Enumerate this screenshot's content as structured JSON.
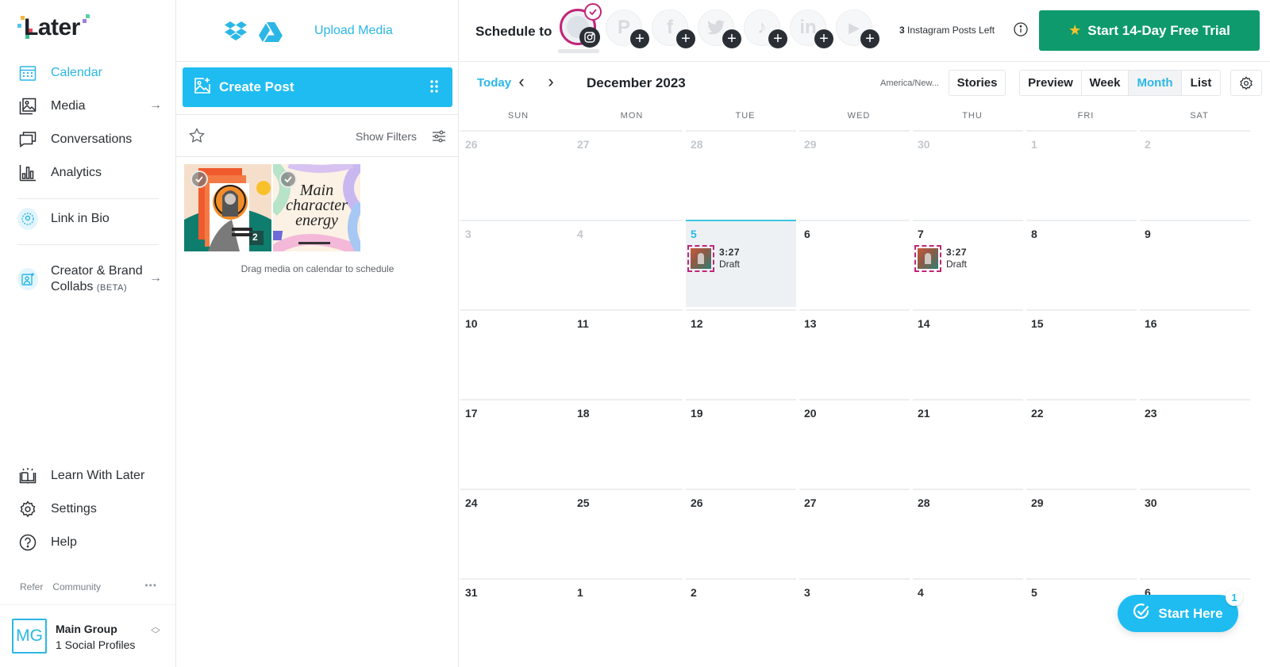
{
  "brand": {
    "name": "Later",
    "accent": "#2bb7e6",
    "trial_green": "#0e9a6c",
    "draft_magenta": "#c0267a"
  },
  "sidebar": {
    "items": [
      {
        "label": "Calendar",
        "icon": "calendar-icon",
        "active": true
      },
      {
        "label": "Media",
        "icon": "media-icon",
        "has_arrow": true
      },
      {
        "label": "Conversations",
        "icon": "conversations-icon"
      },
      {
        "label": "Analytics",
        "icon": "analytics-icon"
      },
      {
        "label": "Link in Bio",
        "icon": "link-in-bio-icon"
      },
      {
        "label": "Creator & Brand",
        "label2": "Collabs",
        "badge": "(BETA)",
        "icon": "collabs-icon",
        "has_arrow": true
      }
    ],
    "bottom_items": [
      {
        "label": "Learn With Later",
        "icon": "book-icon"
      },
      {
        "label": "Settings",
        "icon": "gear-icon"
      },
      {
        "label": "Help",
        "icon": "help-icon"
      }
    ],
    "footer_links": [
      "Refer",
      "Community"
    ],
    "more": "•••",
    "profile": {
      "initials": "MG",
      "name": "Main Group",
      "subtitle": "1 Social Profiles"
    }
  },
  "media_panel": {
    "upload_label": "Upload Media",
    "create_post_label": "Create Post",
    "show_filters_label": "Show Filters",
    "thumbnails": [
      {
        "alt": "Collage post",
        "count": "2"
      },
      {
        "alt": "Main character energy",
        "text_lines": [
          "Main",
          "character",
          "energy"
        ]
      }
    ],
    "drag_hint": "Drag media on calendar to schedule"
  },
  "topbar": {
    "schedule_label": "Schedule to",
    "profiles": [
      {
        "network": "instagram",
        "selected": true
      },
      {
        "network": "pinterest",
        "glyph": "P"
      },
      {
        "network": "facebook",
        "glyph": "f"
      },
      {
        "network": "twitter",
        "glyph": "t"
      },
      {
        "network": "tiktok",
        "glyph": "♪"
      },
      {
        "network": "linkedin",
        "glyph": "in"
      },
      {
        "network": "youtube",
        "glyph": "▶"
      }
    ],
    "posts_left_count": "3",
    "posts_left_text": " Instagram Posts Left",
    "trial_label": "Start 14-Day Free Trial"
  },
  "calendar": {
    "today_label": "Today",
    "month_title": "December 2023",
    "timezone": "America/New...",
    "stories_label": "Stories",
    "views": [
      {
        "label": "Preview",
        "active": false
      },
      {
        "label": "Week",
        "active": false
      },
      {
        "label": "Month",
        "active": true
      },
      {
        "label": "List",
        "active": false
      }
    ],
    "weekdays": [
      "SUN",
      "MON",
      "TUE",
      "WED",
      "THU",
      "FRI",
      "SAT"
    ],
    "weeks": [
      [
        {
          "d": "26",
          "past": true
        },
        {
          "d": "27",
          "past": true
        },
        {
          "d": "28",
          "past": true
        },
        {
          "d": "29",
          "past": true
        },
        {
          "d": "30",
          "past": true
        },
        {
          "d": "1",
          "past": true
        },
        {
          "d": "2",
          "past": true
        }
      ],
      [
        {
          "d": "3",
          "past": true
        },
        {
          "d": "4",
          "past": true
        },
        {
          "d": "5",
          "today": true,
          "events": [
            {
              "time": "3:27",
              "status": "Draft"
            }
          ]
        },
        {
          "d": "6"
        },
        {
          "d": "7",
          "events": [
            {
              "time": "3:27",
              "status": "Draft"
            }
          ]
        },
        {
          "d": "8"
        },
        {
          "d": "9"
        }
      ],
      [
        {
          "d": "10"
        },
        {
          "d": "11"
        },
        {
          "d": "12"
        },
        {
          "d": "13"
        },
        {
          "d": "14"
        },
        {
          "d": "15"
        },
        {
          "d": "16"
        }
      ],
      [
        {
          "d": "17"
        },
        {
          "d": "18"
        },
        {
          "d": "19"
        },
        {
          "d": "20"
        },
        {
          "d": "21"
        },
        {
          "d": "22"
        },
        {
          "d": "23"
        }
      ],
      [
        {
          "d": "24"
        },
        {
          "d": "25"
        },
        {
          "d": "26"
        },
        {
          "d": "27"
        },
        {
          "d": "28"
        },
        {
          "d": "29"
        },
        {
          "d": "30"
        }
      ],
      [
        {
          "d": "31"
        },
        {
          "d": "1"
        },
        {
          "d": "2"
        },
        {
          "d": "3"
        },
        {
          "d": "4"
        },
        {
          "d": "5"
        },
        {
          "d": "6"
        }
      ]
    ]
  },
  "start_here": {
    "label": "Start Here",
    "badge": "1"
  }
}
